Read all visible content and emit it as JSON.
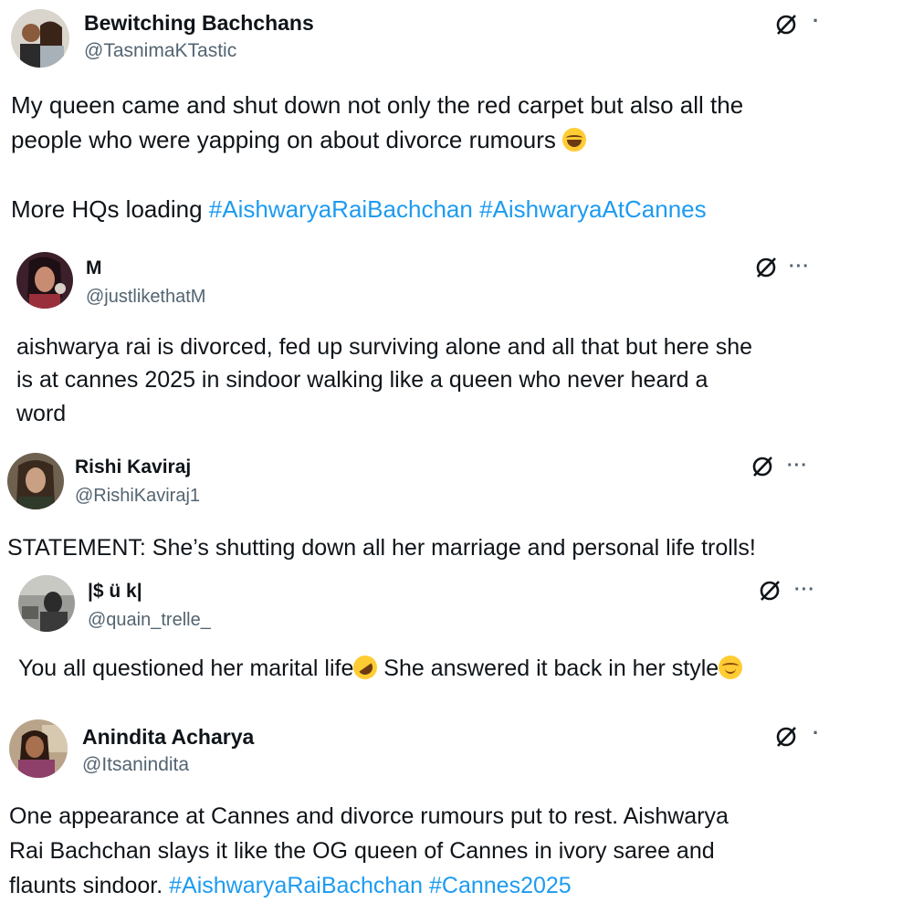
{
  "colors": {
    "text": "#0f1419",
    "secondary": "#536471",
    "link": "#1d9bf0",
    "background": "#ffffff"
  },
  "icons": {
    "grok": "grok-icon",
    "more": "more-options-icon"
  },
  "tweets": [
    {
      "display_name": "Bewitching Bachchans",
      "handle": "@TasnimaKTastic",
      "more": "·",
      "lines": [
        {
          "text": "My queen came and shut down not only the red carpet but also all the"
        },
        {
          "text": "people who were yapping on about divorce rumours",
          "emoji": "face-with-tears-of-joy"
        },
        {
          "text": "More HQs loading",
          "hashtags": [
            "#AishwaryaRaiBachchan",
            "#AishwaryaAtCannes"
          ]
        }
      ]
    },
    {
      "display_name": "M",
      "handle": "@justlikethatM",
      "more": "···",
      "lines": [
        {
          "text": "aishwarya rai is divorced, fed up surviving alone and all that but here she"
        },
        {
          "text": "is at cannes 2025 in sindoor walking like a queen who never heard a"
        },
        {
          "text": "word"
        }
      ]
    },
    {
      "display_name": "Rishi Kaviraj",
      "handle": "@RishiKaviraj1",
      "more": "···",
      "lines": [
        {
          "text": "STATEMENT: She’s shutting down all her marriage and personal life trolls!"
        }
      ]
    },
    {
      "display_name": "|$ ü k|",
      "handle": "@quain_trelle_",
      "more": "···",
      "lines": [
        {
          "text": "You all questioned her marital life",
          "emoji": "rolling-on-the-floor-laughing",
          "text2": " She answered it back in her style",
          "emoji2": "relieved-face"
        }
      ]
    },
    {
      "display_name": "Anindita Acharya",
      "handle": "@Itsanindita",
      "more": "·",
      "lines": [
        {
          "text": "One appearance at Cannes and divorce rumours put to rest. Aishwarya"
        },
        {
          "text": "Rai Bachchan slays it like the OG queen of Cannes in ivory saree and"
        },
        {
          "text": "flaunts sindoor.",
          "hashtags": [
            "#AishwaryaRaiBachchan",
            "#Cannes2025"
          ]
        }
      ]
    }
  ]
}
